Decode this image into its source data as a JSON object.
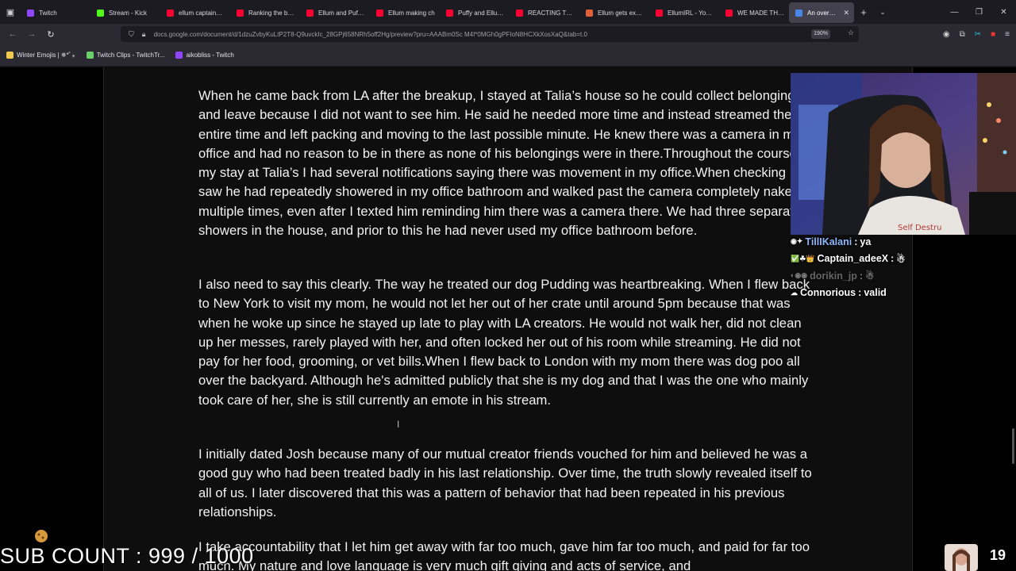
{
  "browser": {
    "tabs": [
      {
        "label": "Twitch",
        "color": "#9146ff"
      },
      {
        "label": "Stream - Kick",
        "color": "#53fc18"
      },
      {
        "label": "ellum captainpuff",
        "color": "#ff0033"
      },
      {
        "label": "Ranking the best",
        "color": "#ff0033"
      },
      {
        "label": "Ellum and Puffy r",
        "color": "#ff0033"
      },
      {
        "label": "Ellum making ch",
        "color": "#ff0033"
      },
      {
        "label": "Puffy and Ellum a",
        "color": "#ff0033"
      },
      {
        "label": "REACTING TO SII",
        "color": "#ff0033"
      },
      {
        "label": "Ellum gets expos",
        "color": "#e0603a"
      },
      {
        "label": "EllumIRL - YouTu",
        "color": "#ff0033"
      },
      {
        "label": "WE MADE THE W",
        "color": "#ff0033"
      },
      {
        "label": "An overdue ex",
        "color": "#4a86e8",
        "active": true
      }
    ],
    "url": "docs.google.com/document/d/1dzuZvbyKuLtP2T8-Q9uvckIc_28GPj658NRh5off2Hg/preview?pru=AAABm0Sc M4I*0MGh0gPFIoN8HCXkXosXaQ&tab=t.0",
    "zoom": "190%",
    "bookmarks": [
      {
        "label": "Winter Emojis | ❄*ﾟ⁎",
        "color": "#f2c94c"
      },
      {
        "label": "Twitch Clips - TwitchTr...",
        "color": "#6ad16a"
      },
      {
        "label": "aikobliss - Twitch",
        "color": "#9146ff"
      }
    ]
  },
  "document": {
    "paragraphs": [
      "When he came back from LA after the breakup, I stayed at Talia’s house so he could collect belongings and leave because I did not want to see him. He said he needed more time and instead streamed the entire time and left packing and moving to the last possible minute. He knew there was a camera in my office and had no reason to be in there as none of his belongings were in there.Throughout the course of my stay at Talia’s I had several notifications saying there was movement in my office.When checking I saw he had repeatedly showered in my office bathroom and walked past the camera completely naked multiple times, even after I texted him reminding him there was a camera there. We had three separate showers in the house, and prior to this he had never used my office bathroom before.",
      "I also need to say this clearly. The way he treated our dog Pudding was heartbreaking. When I flew back to New York to visit my mom, he would not let her out of her crate until around 5pm because that was when he woke up since he stayed up late to play with LA creators. He would not walk her, did not clean up her messes, rarely played with her, and often locked her out of his room while streaming. He did not pay for her food, grooming, or vet bills.When I flew back to London with my mom there was dog poo all over the backyard. Although he's admitted publicly that she is my dog and that I was the one who mainly took care of her, she is still currently an emote in his stream.",
      "I initially dated Josh because many of our mutual creator friends vouched for him and believed he was a good guy who had been treated badly in his last relationship. Over time, the truth slowly revealed itself to all of us. I later discovered that this was a pattern of behavior that had been repeated in his previous relationships.",
      "I take accountability that I let him get away with far too much, gave him far too much, and paid for far too much. My nature and love language is very much gift giving and acts of service, and"
    ]
  },
  "chat": [
    {
      "user": "TillIKalani",
      "msg": "ya",
      "badges": "◉✦",
      "color": "#8fb8ff",
      "dim": false
    },
    {
      "user": "Captain_adeeX",
      "msg": "☃",
      "badges": "✅☘👑",
      "color": "#ffffff",
      "dim": false
    },
    {
      "user": "dorikin_jp",
      "msg": "☃",
      "badges": "◐◉◉",
      "color": "#cccccc",
      "dim": true
    },
    {
      "user": "Connorious",
      "msg": "valid",
      "badges": "☁",
      "color": "#ffffff",
      "dim": false
    }
  ],
  "overlay": {
    "sub_count": "SUB COUNT : 999 / 1000",
    "viewer_count": "19"
  }
}
